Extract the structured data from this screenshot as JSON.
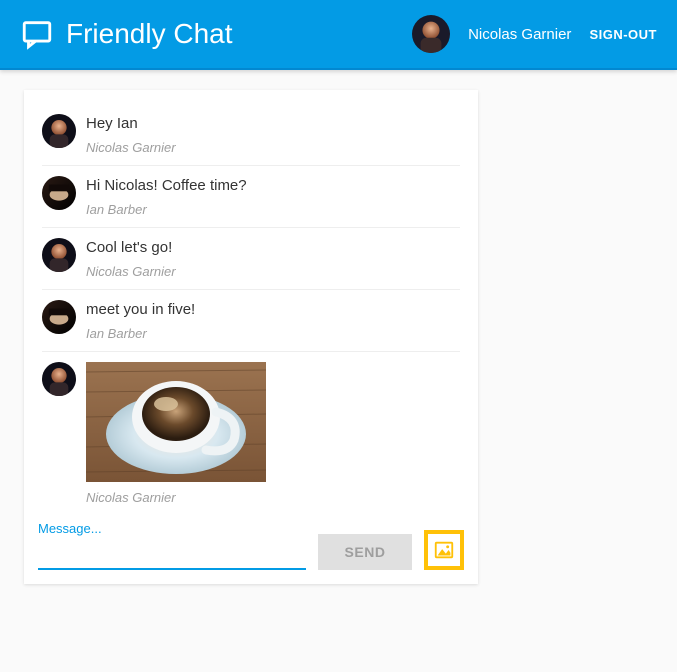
{
  "header": {
    "title": "Friendly Chat",
    "username": "Nicolas Garnier",
    "signout_label": "SIGN-OUT"
  },
  "messages": [
    {
      "text": "Hey Ian",
      "sender": "Nicolas Garnier",
      "avatar": "nicolas",
      "type": "text"
    },
    {
      "text": "Hi Nicolas! Coffee time?",
      "sender": "Ian Barber",
      "avatar": "ian",
      "type": "text"
    },
    {
      "text": "Cool let's go!",
      "sender": "Nicolas Garnier",
      "avatar": "nicolas",
      "type": "text"
    },
    {
      "text": "meet you in five!",
      "sender": "Ian Barber",
      "avatar": "ian",
      "type": "text"
    },
    {
      "text": "",
      "sender": "Nicolas Garnier",
      "avatar": "nicolas",
      "type": "image",
      "image": "coffee"
    }
  ],
  "compose": {
    "placeholder_label": "Message...",
    "input_value": "",
    "send_label": "SEND"
  }
}
